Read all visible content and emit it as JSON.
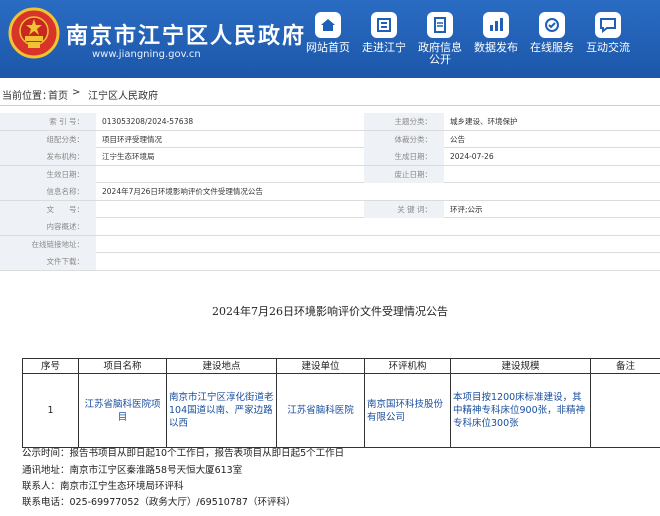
{
  "header": {
    "title": "南京市江宁区人民政府",
    "url": "www.jiangning.gov.cn",
    "nav": [
      {
        "label": "网站首页",
        "icon": "home-icon"
      },
      {
        "label": "走进江宁",
        "icon": "building-icon"
      },
      {
        "label": "政府信息公开",
        "label2": "公开",
        "label1": "政府信息",
        "icon": "document-icon"
      },
      {
        "label": "数据发布",
        "icon": "data-icon"
      },
      {
        "label": "在线服务",
        "icon": "service-icon"
      },
      {
        "label": "互动交流",
        "icon": "chat-icon"
      }
    ]
  },
  "breadcrumb": {
    "prefix": "当前位置：",
    "home": "首页",
    "sep": ">",
    "current": "江宁区人民政府"
  },
  "info": {
    "rows": [
      {
        "l1": "索 引 号：",
        "v1": "013053208/2024-57638",
        "l2": "主题分类：",
        "v2": "城乡建设、环境保护"
      },
      {
        "l1": "组配分类：",
        "v1": "项目环评受理情况",
        "l2": "体裁分类：",
        "v2": "公告"
      },
      {
        "l1": "发布机构：",
        "v1": "江宁生态环境局",
        "l2": "生成日期：",
        "v2": "2024-07-26"
      },
      {
        "l1": "生效日期：",
        "v1": "",
        "l2": "废止日期：",
        "v2": ""
      },
      {
        "l1": "信息名称：",
        "v1": "2024年7月26日环境影响评价文件受理情况公告",
        "full": true
      },
      {
        "l1": "文　　号：",
        "v1": "",
        "l2": "关 键 词：",
        "v2": "环评;公示"
      },
      {
        "l1": "内容概述：",
        "v1": "",
        "full": true
      },
      {
        "l1": "在线链接地址：",
        "v1": "",
        "full": true
      },
      {
        "l1": "文件下载：",
        "v1": "",
        "full": true
      }
    ]
  },
  "announcement": {
    "title": "2024年7月26日环境影响评价文件受理情况公告",
    "headers": [
      "序号",
      "项目名称",
      "建设地点",
      "建设单位",
      "环评机构",
      "建设规模",
      "备注"
    ],
    "row": {
      "no": "1",
      "name": "江苏省脑科医院项目",
      "location": "南京市江宁区淳化街道老104国道以南、严家边路以西",
      "builder": "江苏省脑科医院",
      "agency": "南京国环科技股份有限公司",
      "scale": "本项目按1200床标准建设，其中精神专科床位900张，非精神专科床位300张",
      "remark": ""
    },
    "notes": {
      "time": "公示时间：报告书项目从即日起10个工作日，报告表项目从即日起5个工作日",
      "address": "通讯地址：南京市江宁区秦淮路58号天恒大厦613室",
      "contact": "联系人：南京市江宁生态环境局环评科",
      "phone": "联系电话：025-69977052（政务大厅）/69510787（环评科）"
    }
  },
  "colors": {
    "header_blue": "#1f5fb7",
    "label_bg": "#eef1f6",
    "link_blue": "#1a4fa0"
  }
}
